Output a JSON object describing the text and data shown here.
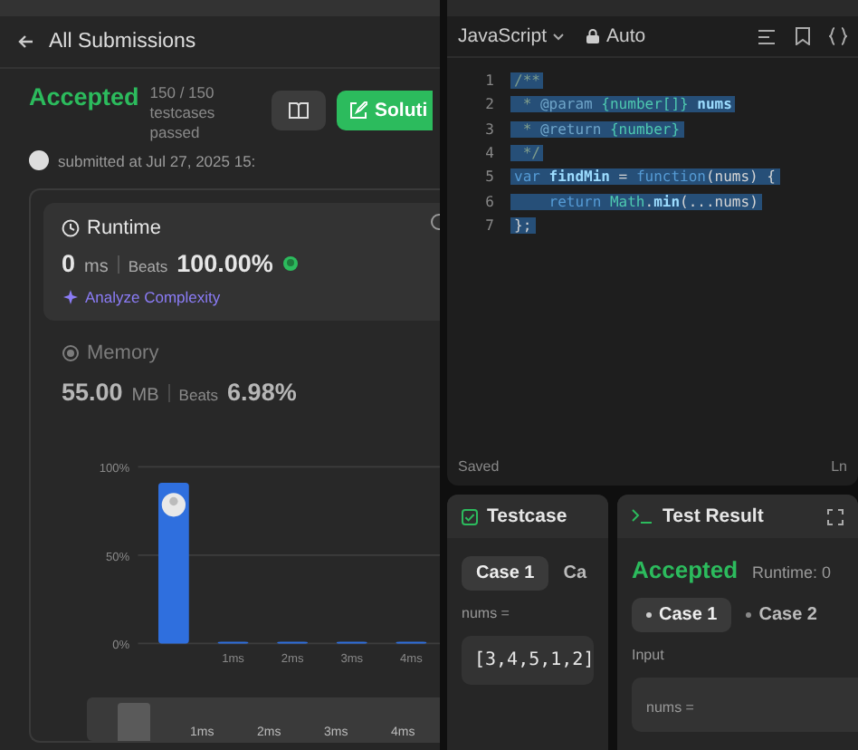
{
  "submission": {
    "back_label": "All Submissions",
    "status": "Accepted",
    "testcases": "150 / 150 testcases passed",
    "submitted": "submitted at Jul 27, 2025 15:",
    "solution_button": "Soluti",
    "runtime": {
      "title": "Runtime",
      "value": "0",
      "unit": "ms",
      "beats_label": "Beats",
      "beats": "100.00%",
      "analyze": "Analyze Complexity"
    },
    "memory": {
      "title": "Memory",
      "value": "55.00",
      "unit": "MB",
      "beats_label": "Beats",
      "beats": "6.98%"
    },
    "chart_data": {
      "type": "bar",
      "categories": [
        null,
        "1ms",
        "2ms",
        "3ms",
        "4ms"
      ],
      "values": [
        91,
        1,
        1,
        1,
        1
      ],
      "ylim": [
        0,
        100
      ],
      "yticks": [
        {
          "value": 0,
          "label": "0%"
        },
        {
          "value": 50,
          "label": "50%"
        },
        {
          "value": 100,
          "label": "100%"
        }
      ]
    },
    "range_labels": [
      "1ms",
      "2ms",
      "3ms",
      "4ms"
    ]
  },
  "editor": {
    "language": "JavaScript",
    "mode": "Auto",
    "selected": true,
    "status": "Saved",
    "position": "Ln",
    "lines": [
      {
        "number": "1",
        "tokens": [
          {
            "kind": "comment",
            "text": "/**"
          }
        ]
      },
      {
        "number": "2",
        "tokens": [
          {
            "kind": "comment",
            "text": " * "
          },
          {
            "kind": "tag",
            "text": "@param"
          },
          {
            "kind": "type",
            "text": " {number[]}"
          },
          {
            "kind": "name",
            "text": " nums"
          }
        ]
      },
      {
        "number": "3",
        "tokens": [
          {
            "kind": "comment",
            "text": " * "
          },
          {
            "kind": "tag",
            "text": "@return"
          },
          {
            "kind": "type",
            "text": " {number}"
          }
        ]
      },
      {
        "number": "4",
        "tokens": [
          {
            "kind": "comment",
            "text": " */"
          }
        ]
      },
      {
        "number": "5",
        "tokens": [
          {
            "kind": "keyword",
            "text": "var "
          },
          {
            "kind": "name",
            "text": "findMin"
          },
          {
            "kind": "plain",
            "text": " = "
          },
          {
            "kind": "keyword",
            "text": "function"
          },
          {
            "kind": "plain",
            "text": "(nums) {"
          }
        ]
      },
      {
        "number": "6",
        "tokens": [
          {
            "kind": "keyword",
            "text": "    return "
          },
          {
            "kind": "type",
            "text": "Math"
          },
          {
            "kind": "plain",
            "text": "."
          },
          {
            "kind": "name",
            "text": "min"
          },
          {
            "kind": "plain",
            "text": "(...nums)"
          }
        ]
      },
      {
        "number": "7",
        "tokens": [
          {
            "kind": "plain",
            "text": "};"
          }
        ]
      }
    ]
  },
  "testcase": {
    "title": "Testcase",
    "tabs": [
      {
        "label": "Case 1",
        "selected": true
      },
      {
        "label": "Ca",
        "selected": false
      }
    ],
    "param": "nums =",
    "value": "[3,4,5,1,2]"
  },
  "test_result": {
    "title": "Test Result",
    "status": "Accepted",
    "runtime": "Runtime: 0",
    "cases": [
      {
        "label": "Case 1",
        "selected": true
      },
      {
        "label": "Case 2",
        "selected": false
      }
    ],
    "input_label": "Input",
    "param": "nums ="
  }
}
